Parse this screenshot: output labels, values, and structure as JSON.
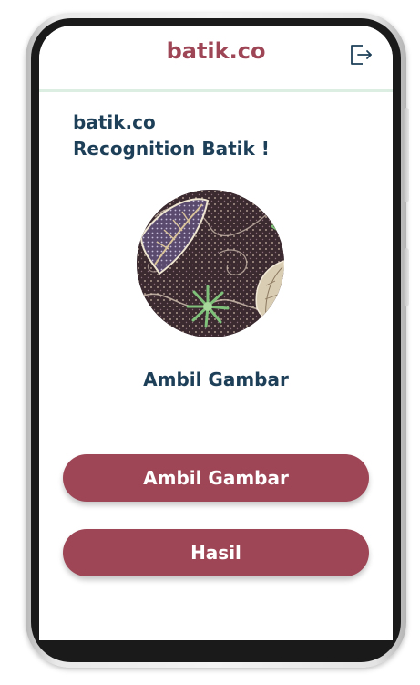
{
  "header": {
    "title": "batik.co",
    "logout_icon": "logout-icon"
  },
  "intro": {
    "line1": "batik.co",
    "line2": "Recognition Batik !"
  },
  "preview": {
    "caption": "Ambil Gambar"
  },
  "buttons": {
    "take_photo": "Ambil Gambar",
    "result": "Hasil"
  },
  "colors": {
    "accent": "#9e4656",
    "heading": "#1d3f58",
    "divider": "#dceee2"
  }
}
